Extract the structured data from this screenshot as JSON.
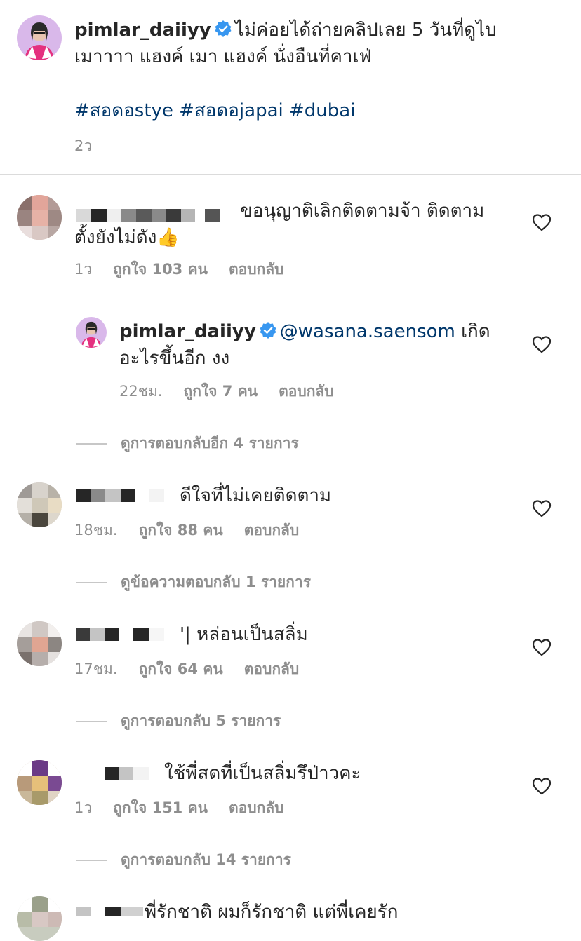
{
  "caption": {
    "username": "pimlar_daiiyy",
    "line1": "ไม่ค่อยได้ถ่ายคลิปเลย 5 วันที่ดูไบ",
    "line2": "เมาาาา แฮงค์ เมา แฮงค์  นั่งอืนที่คาเฟ่",
    "hashtags": "#สอดอstye #สอดอjapai #dubai",
    "time": "2ว"
  },
  "comments": [
    {
      "text_part1": "ขอนุญาติเลิกติดตามจ้า ติดตาม",
      "text_part2": "ตั้งยังไม่ดัง",
      "emoji": "👍",
      "time": "1ว",
      "likes": "ถูกใจ 103 คน",
      "reply": "ตอบกลับ"
    },
    {
      "username": "pimlar_daiiyy",
      "mention": "@wasana.saensom",
      "text_part1": " เกิด",
      "text_part2": "อะไรขึ้นอีก งง",
      "time": "22ชม.",
      "likes": "ถูกใจ 7 คน",
      "reply": "ตอบกลับ"
    },
    {
      "text": "ดีใจที่ไม่เคยติดตาม",
      "time": "18ชม.",
      "likes": "ถูกใจ 88 คน",
      "reply": "ตอบกลับ"
    },
    {
      "text": "'| หล่อนเป็นสลิ่ม",
      "time": "17ชม.",
      "likes": "ถูกใจ 64 คน",
      "reply": "ตอบกลับ"
    },
    {
      "text": "ใช้พี่สดที่เป็นสลิ่มรึป่าวคะ",
      "time": "1ว",
      "likes": "ถูกใจ 151 คน",
      "reply": "ตอบกลับ"
    },
    {
      "text": "พี่รักชาติ ผมก็รักชาติ แต่พี่เคยรัก"
    }
  ],
  "view_more": [
    "ดูการตอบกลับอีก 4 รายการ",
    "ดูข้อความตอบกลับ 1 รายการ",
    "ดูการตอบกลับ 5 รายการ",
    "ดูการตอบกลับ 14 รายการ"
  ],
  "colors": {
    "hashtag": "#00376b",
    "meta": "#8e8e8e",
    "verified": "#3897f0",
    "avatar_bg": "#d9b8ea",
    "outfit": "#e4307f"
  },
  "icons": [
    "verified-badge-icon",
    "heart-icon"
  ]
}
